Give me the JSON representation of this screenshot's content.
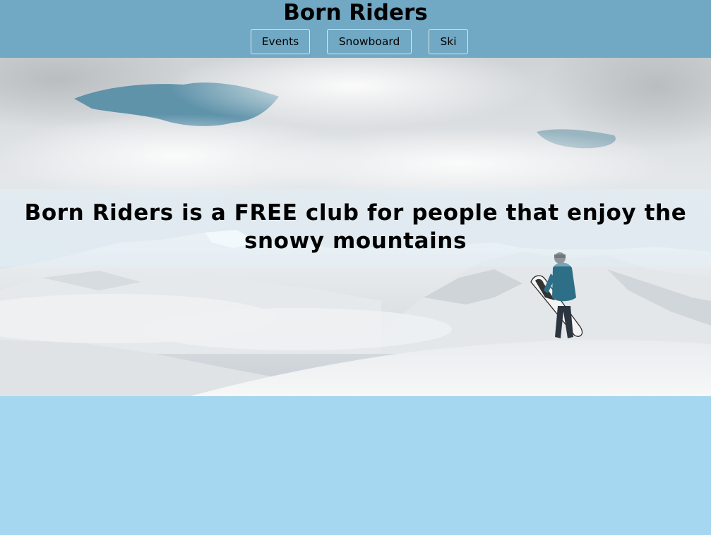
{
  "site": {
    "title": "Born Riders"
  },
  "nav": {
    "items": [
      "Events",
      "Snowboard",
      "Ski"
    ]
  },
  "hero": {
    "headline": "Born Riders is a FREE club for people that enjoy the snowy mountains"
  },
  "colors": {
    "header_bg": "#71a8c3",
    "page_bg": "#a5d8f0",
    "button_border": "#dde9ef"
  },
  "icons": {
    "hero_image": "snowboarder-mountain-image"
  }
}
